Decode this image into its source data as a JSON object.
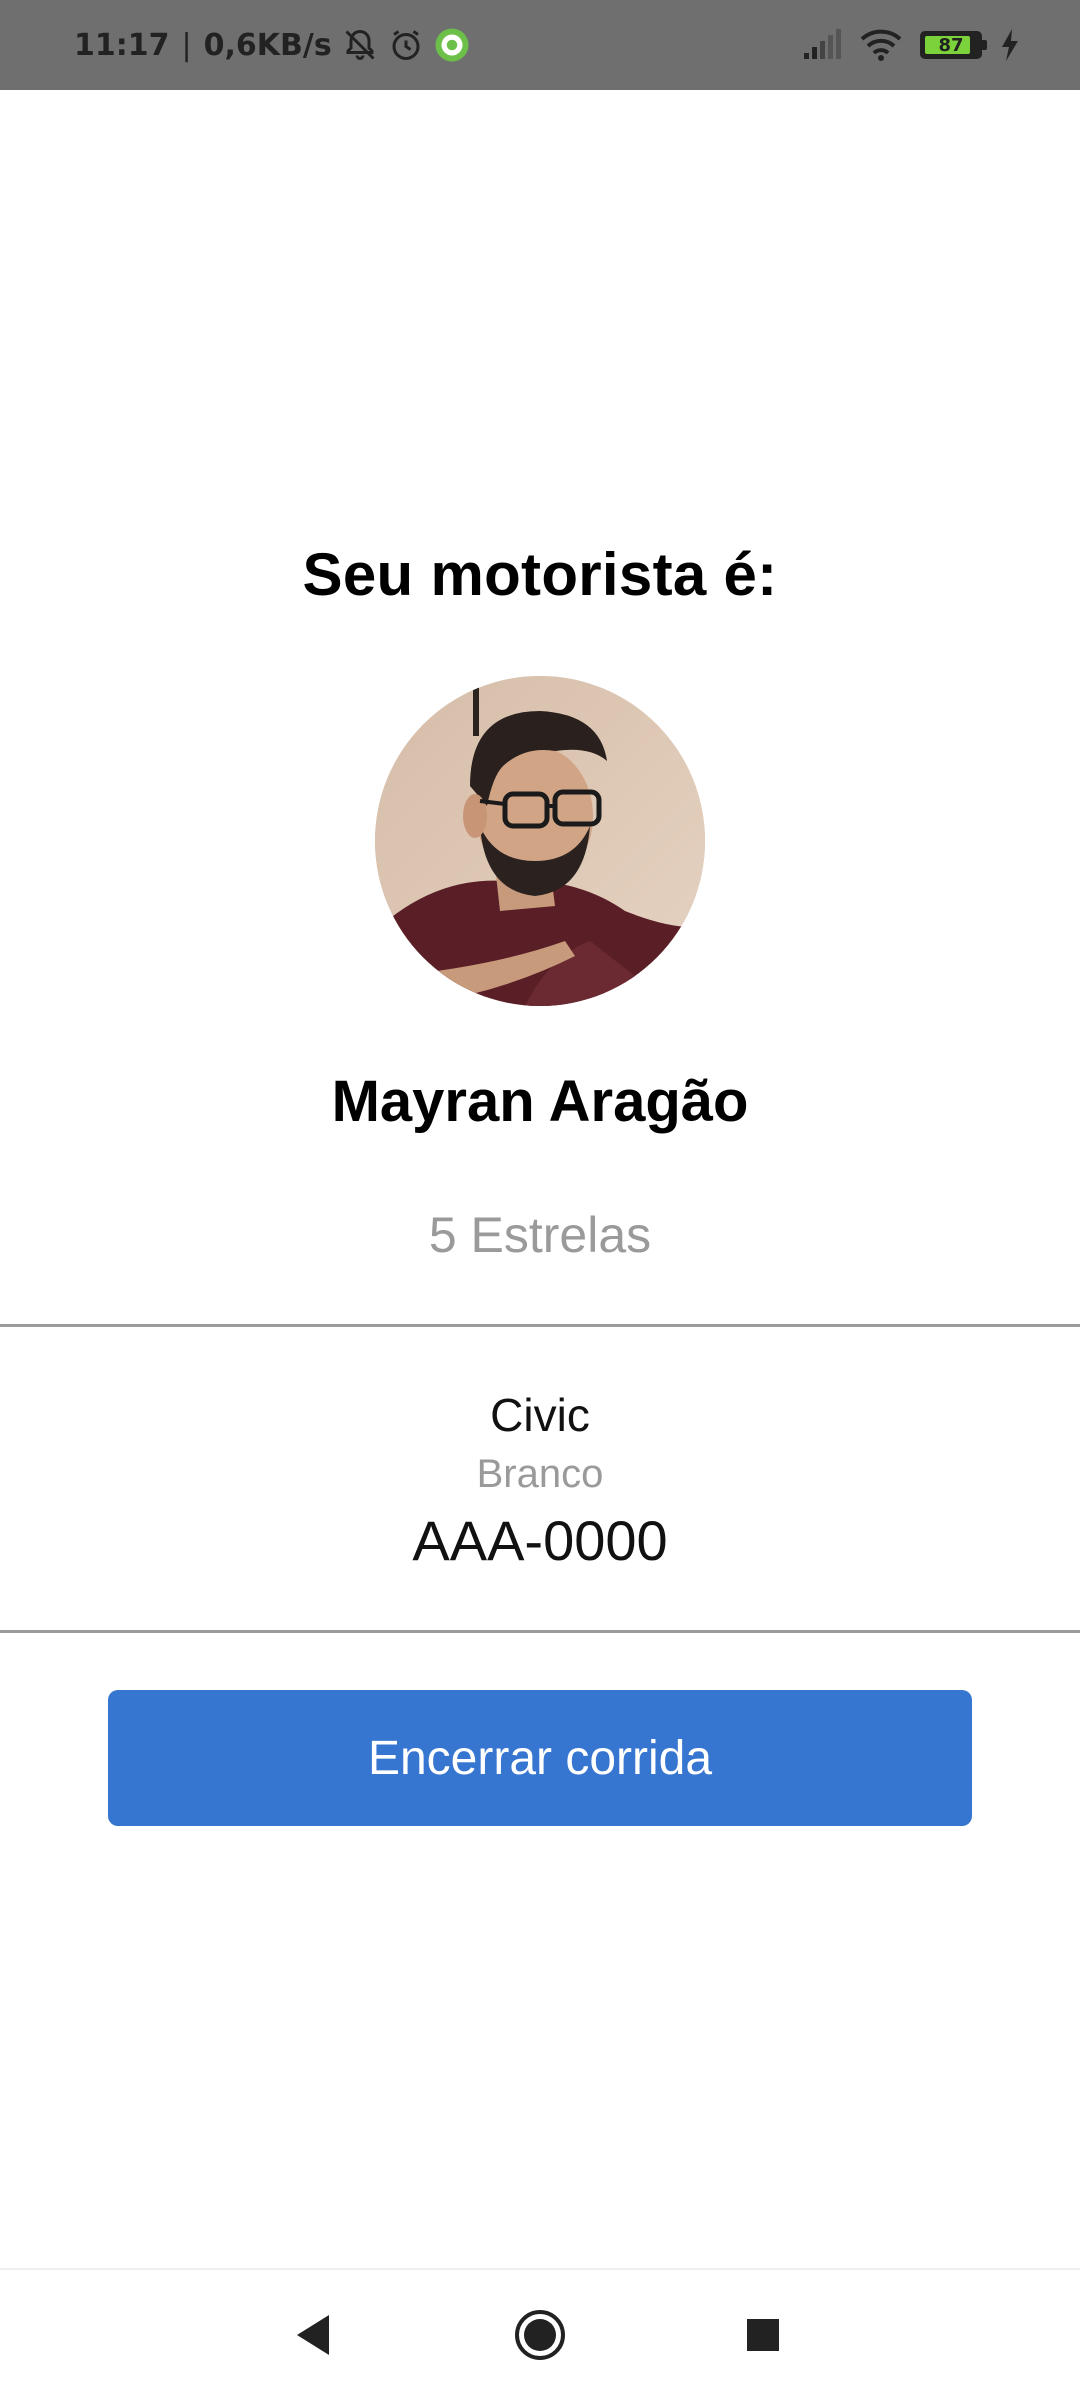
{
  "status_bar": {
    "time": "11:17",
    "net_speed": "0,6KB/s",
    "battery_level": "87",
    "battery_fraction": 0.87,
    "icons": [
      "silent-bell-icon",
      "alarm-icon",
      "app-notification-icon",
      "signal-icon",
      "wifi-icon",
      "battery-icon",
      "charging-bolt-icon"
    ]
  },
  "screen": {
    "title": "Seu motorista é:",
    "driver_name": "Mayran Aragão",
    "rating": "5 Estrelas",
    "car": {
      "model": "Civic",
      "color": "Branco",
      "plate": "AAA-0000"
    },
    "end_ride_button": "Encerrar corrida"
  },
  "nav_bar": {
    "icons": [
      "back-icon",
      "home-icon",
      "recents-icon"
    ]
  },
  "colors": {
    "status_bar_bg": "#6f6f6f",
    "button_bg": "#3676d0",
    "muted_text": "#9a9a9a",
    "divider": "#9b9b9b",
    "battery_fill": "#7bd23a"
  }
}
